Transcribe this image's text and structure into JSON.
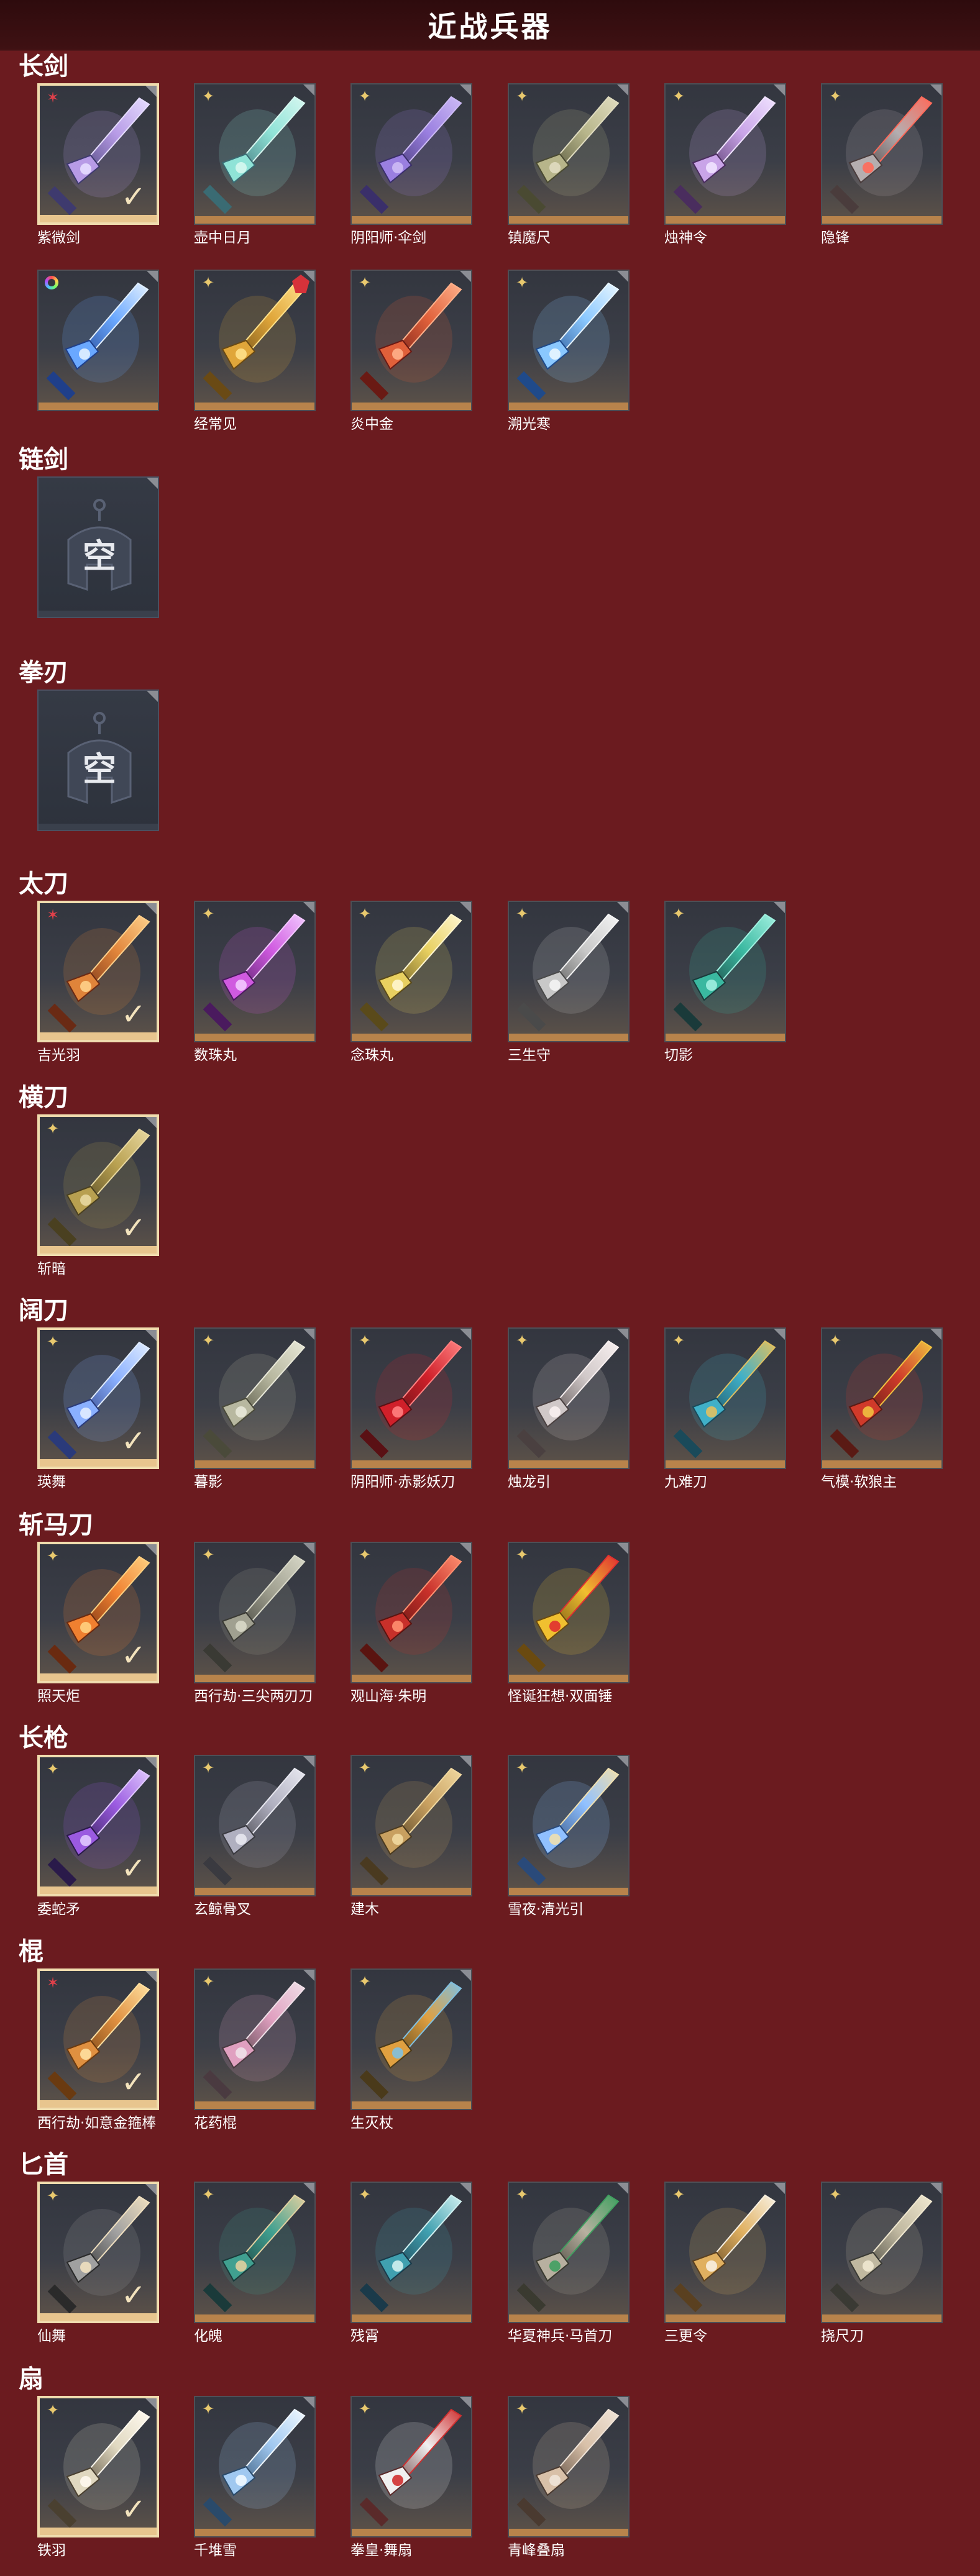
{
  "title": "近战兵器",
  "colors": {
    "background": "#6b1b1f",
    "title_bar": "#3f1113",
    "card_bottom": "#b8834b",
    "selected_border": "#f0dcae",
    "star_gold": "#e9c96e",
    "star_red": "#e0404a"
  },
  "sections": [
    {
      "name": "长剑",
      "items": [
        {
          "label": "紫微剑",
          "badge": "red-star-icon",
          "selected": true,
          "colors": [
            "#3e3a6e",
            "#b79be6",
            "#e6ddff"
          ]
        },
        {
          "label": "壶中日月",
          "badge": "gold-star-icon",
          "selected": false,
          "colors": [
            "#3a6b73",
            "#8fe3d7",
            "#d6f7f0"
          ]
        },
        {
          "label": "阴阳师·伞剑",
          "badge": "gold-star-icon",
          "selected": false,
          "colors": [
            "#3a2f6a",
            "#9a7fe0",
            "#cdbbf5"
          ]
        },
        {
          "label": "镇魔尺",
          "badge": "gold-star-icon",
          "selected": false,
          "colors": [
            "#4a4a32",
            "#b7b58a",
            "#e0dcc0"
          ]
        },
        {
          "label": "烛神令",
          "badge": "gold-star-icon",
          "selected": false,
          "colors": [
            "#4a2d5e",
            "#c9a4e8",
            "#f0e2ff"
          ]
        },
        {
          "label": "隐锋",
          "badge": "gold-star-icon",
          "selected": false,
          "colors": [
            "#4a3c3c",
            "#b5aeb0",
            "#ff6a5a"
          ]
        },
        {
          "label": "",
          "badge": "rainbow-ring-icon",
          "selected": false,
          "colors": [
            "#1f3f8a",
            "#6aa8ff",
            "#e2f0ff"
          ]
        },
        {
          "label": "经常见",
          "badge": "gold-star-icon",
          "selected": false,
          "colors": [
            "#6a4a14",
            "#e0a63a",
            "#ffe18a"
          ],
          "corner": "red-badge-icon"
        },
        {
          "label": "炎中金",
          "badge": "gold-star-icon",
          "selected": false,
          "colors": [
            "#6a1a14",
            "#e0603a",
            "#ffb08a"
          ]
        },
        {
          "label": "溯光寒",
          "badge": "gold-star-icon",
          "selected": false,
          "colors": [
            "#1f4a8a",
            "#8ac8ff",
            "#e8f6ff"
          ]
        }
      ]
    },
    {
      "name": "链剑",
      "empty": true,
      "empty_text": "空",
      "items": []
    },
    {
      "name": "拳刃",
      "empty": true,
      "empty_text": "空",
      "items": []
    },
    {
      "name": "太刀",
      "items": [
        {
          "label": "吉光羽",
          "badge": "red-star-icon",
          "selected": true,
          "colors": [
            "#6a2a14",
            "#e0843a",
            "#ffd08a"
          ]
        },
        {
          "label": "数珠丸",
          "badge": "gold-star-icon",
          "selected": false,
          "colors": [
            "#4a1a5e",
            "#d05ae0",
            "#f2c8ff"
          ]
        },
        {
          "label": "念珠丸",
          "badge": "gold-star-icon",
          "selected": false,
          "colors": [
            "#5a4a1a",
            "#e8d060",
            "#fff6d0"
          ]
        },
        {
          "label": "三生守",
          "badge": "gold-star-icon",
          "selected": false,
          "colors": [
            "#4a4a4a",
            "#c8c8c8",
            "#f4f4f4"
          ]
        },
        {
          "label": "切影",
          "badge": "gold-star-icon",
          "selected": false,
          "colors": [
            "#1a3a3a",
            "#3ab8a0",
            "#a0f0e0"
          ]
        }
      ]
    },
    {
      "name": "横刀",
      "items": [
        {
          "label": "斩暗",
          "badge": "gold-star-icon",
          "selected": true,
          "colors": [
            "#4a4020",
            "#b8a050",
            "#e8d8a0"
          ]
        }
      ]
    },
    {
      "name": "阔刀",
      "items": [
        {
          "label": "瑛舞",
          "badge": "gold-star-icon",
          "selected": true,
          "colors": [
            "#2a3a7a",
            "#8ab0ff",
            "#e0ecff"
          ]
        },
        {
          "label": "暮影",
          "badge": "gold-star-icon",
          "selected": false,
          "colors": [
            "#4a4a3a",
            "#b8b8a0",
            "#e8e8d8"
          ]
        },
        {
          "label": "阴阳师·赤影妖刀",
          "badge": "gold-star-icon",
          "selected": false,
          "colors": [
            "#5a1014",
            "#d0202a",
            "#ff8080"
          ]
        },
        {
          "label": "烛龙引",
          "badge": "gold-star-icon",
          "selected": false,
          "colors": [
            "#4a4040",
            "#d0c8c8",
            "#f8f0f0"
          ]
        },
        {
          "label": "九难刀",
          "badge": "gold-star-icon",
          "selected": false,
          "colors": [
            "#1a4a5a",
            "#40b0c8",
            "#e0c060"
          ]
        },
        {
          "label": "气模·软狼主",
          "badge": "gold-star-icon",
          "selected": false,
          "colors": [
            "#5a1a14",
            "#d03a2a",
            "#f0c040"
          ]
        }
      ]
    },
    {
      "name": "斩马刀",
      "items": [
        {
          "label": "照天炬",
          "badge": "gold-star-icon",
          "selected": true,
          "colors": [
            "#6a2a10",
            "#f08030",
            "#ffd080"
          ]
        },
        {
          "label": "西行劫·三尖两刃刀",
          "badge": "gold-star-icon",
          "selected": false,
          "colors": [
            "#3a3a34",
            "#a0a090",
            "#d8d8c8"
          ]
        },
        {
          "label": "观山海·朱明",
          "badge": "gold-star-icon",
          "selected": false,
          "colors": [
            "#5a1410",
            "#c8302a",
            "#ff9070"
          ]
        },
        {
          "label": "怪诞狂想·双面锤",
          "badge": "gold-star-icon",
          "selected": false,
          "colors": [
            "#6a4a10",
            "#f0c030",
            "#e03030"
          ]
        }
      ]
    },
    {
      "name": "长枪",
      "items": [
        {
          "label": "委蛇矛",
          "badge": "gold-star-icon",
          "selected": true,
          "colors": [
            "#2a1a4a",
            "#9a5ae0",
            "#e0c8ff"
          ]
        },
        {
          "label": "玄鲸骨叉",
          "badge": "gold-star-icon",
          "selected": false,
          "colors": [
            "#3a3a40",
            "#b0b0c0",
            "#e8e8f0"
          ]
        },
        {
          "label": "建木",
          "badge": "gold-star-icon",
          "selected": false,
          "colors": [
            "#4a3a20",
            "#c8a060",
            "#f0d8a0"
          ]
        },
        {
          "label": "雪夜·清光引",
          "badge": "gold-star-icon",
          "selected": false,
          "colors": [
            "#2a4a7a",
            "#90c0ff",
            "#f0e0b0"
          ]
        }
      ]
    },
    {
      "name": "棍",
      "items": [
        {
          "label": "西行劫·如意金箍棒",
          "badge": "red-star-icon",
          "selected": true,
          "colors": [
            "#6a3a10",
            "#e09040",
            "#ffe0a0"
          ]
        },
        {
          "label": "花药棍",
          "badge": "gold-star-icon",
          "selected": false,
          "colors": [
            "#4a3a40",
            "#e0a0c0",
            "#f0e0e8"
          ]
        },
        {
          "label": "生灭杖",
          "badge": "gold-star-icon",
          "selected": false,
          "colors": [
            "#4a3a1a",
            "#e0a040",
            "#80c0e0"
          ]
        }
      ]
    },
    {
      "name": "匕首",
      "items": [
        {
          "label": "仙舞",
          "badge": "gold-star-icon",
          "selected": true,
          "colors": [
            "#2a2a2a",
            "#a0a0a0",
            "#f0e0c0"
          ]
        },
        {
          "label": "化魄",
          "badge": "gold-star-icon",
          "selected": false,
          "colors": [
            "#1a3a3a",
            "#40a090",
            "#e0d0a0"
          ]
        },
        {
          "label": "残霄",
          "badge": "gold-star-icon",
          "selected": false,
          "colors": [
            "#1a3a4a",
            "#40a0b0",
            "#d0f0f0"
          ]
        },
        {
          "label": "华夏神兵·马首刀",
          "badge": "gold-star-icon",
          "selected": false,
          "colors": [
            "#3a3a30",
            "#b8b0a0",
            "#40a060"
          ]
        },
        {
          "label": "三更令",
          "badge": "gold-star-icon",
          "selected": false,
          "colors": [
            "#5a4020",
            "#e0b060",
            "#f8f0e0"
          ]
        },
        {
          "label": "挠尺刀",
          "badge": "gold-star-icon",
          "selected": false,
          "colors": [
            "#3a3a34",
            "#c0b8a0",
            "#f0e8d0"
          ]
        }
      ]
    },
    {
      "name": "扇",
      "items": [
        {
          "label": "铁羽",
          "badge": "gold-star-icon",
          "selected": true,
          "colors": [
            "#4a4030",
            "#e0d8c0",
            "#fffaf0"
          ]
        },
        {
          "label": "千堆雪",
          "badge": "gold-star-icon",
          "selected": false,
          "colors": [
            "#2a4a6a",
            "#a0c8f0",
            "#f0f8ff"
          ]
        },
        {
          "label": "拳皇·舞扇",
          "badge": "gold-star-icon",
          "selected": false,
          "colors": [
            "#5a2a2a",
            "#f0f0f0",
            "#d03030"
          ]
        },
        {
          "label": "青峰叠扇",
          "badge": "gold-star-icon",
          "selected": false,
          "colors": [
            "#4a3a30",
            "#d8c0a8",
            "#f0e4d8"
          ]
        }
      ]
    }
  ]
}
